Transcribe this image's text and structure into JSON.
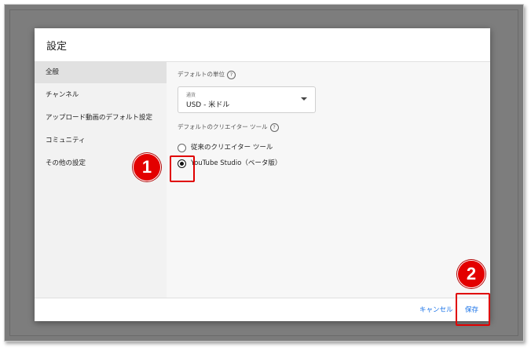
{
  "dialog": {
    "title": "設定"
  },
  "sidebar": {
    "items": [
      {
        "label": "全般",
        "active": true
      },
      {
        "label": "チャンネル",
        "active": false
      },
      {
        "label": "アップロード動画のデフォルト設定",
        "active": false
      },
      {
        "label": "コミュニティ",
        "active": false
      },
      {
        "label": "その他の設定",
        "active": false
      }
    ]
  },
  "main": {
    "units_label": "デフォルトの単位",
    "currency": {
      "caption": "通貨",
      "value": "USD - 米ドル"
    },
    "creator_tool_label": "デフォルトのクリエイター ツール",
    "radio_options": [
      {
        "label": "従来のクリエイター ツール",
        "checked": false
      },
      {
        "label": "YouTube Studio（ベータ版）",
        "checked": true
      }
    ],
    "help_icon_glyph": "?"
  },
  "footer": {
    "cancel_label": "キャンセル",
    "save_label": "保存"
  },
  "annotations": {
    "badge1": "1",
    "badge2": "2",
    "color": "#e30000"
  }
}
